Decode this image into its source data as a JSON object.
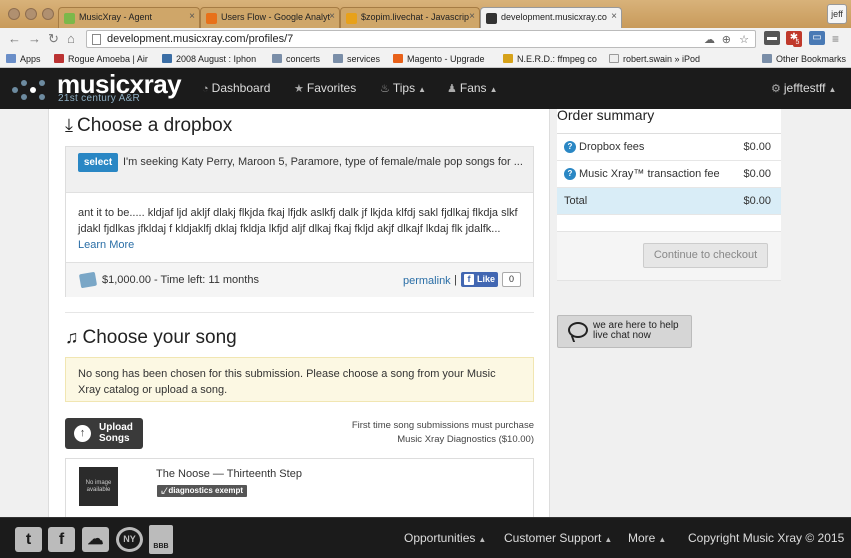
{
  "browser": {
    "tabs": [
      {
        "label": "MusicXray - Agent",
        "fav_color": "#7cb84a"
      },
      {
        "label": "Users Flow - Google Analyt",
        "fav_color": "#e8711a"
      },
      {
        "label": "$zopim.livechat - Javascrip",
        "fav_color": "#e8a11a"
      },
      {
        "label": "development.musicxray.co",
        "fav_color": "#333333"
      }
    ],
    "user_chip": "jeff",
    "url": "development.musicxray.com/profiles/7",
    "ext_badge": "5",
    "bookmarks": [
      {
        "label": "Apps"
      },
      {
        "label": "Rogue Amoeba | Air"
      },
      {
        "label": "2008 August : Iphon"
      },
      {
        "label": "concerts"
      },
      {
        "label": "services"
      },
      {
        "label": "Magento - Upgrade"
      },
      {
        "label": "N.E.R.D.: ffmpeg co"
      },
      {
        "label": "robert.swain » iPod"
      }
    ],
    "other_bookmarks": "Other Bookmarks"
  },
  "site_nav": {
    "logo": "musicxray",
    "tagline": "21st century A&R",
    "dashboard": "Dashboard",
    "favorites": "Favorites",
    "tips": "Tips",
    "fans": "Fans",
    "user": "jefftestff"
  },
  "dropbox_section": {
    "title": "Choose a dropbox",
    "select_label": "select",
    "dropbox_title": "I'm seeking Katy Perry, Maroon 5, Paramore, type of female/male pop songs for ...",
    "description": "ant it to be..... kldjaf ljd akljf dlakj flkjda fkaj lfjdk aslkfj dalk jf lkjda klfdj sakl fjdlkaj flkdja slkf jdakl fjdlkas jfkldaj f kldjaklfj dklaj fkldja lkfjd aljf dlkaj fkaj fkljd akjf dlkajf lkdaj flk jdalfk...",
    "learn_more": "Learn More",
    "price_time": "$1,000.00 - Time left: 11 months",
    "permalink": "permalink",
    "pipe": "|",
    "like_label": "Like",
    "like_count": "0"
  },
  "song_section": {
    "title": "Choose your song",
    "notice": "No song has been chosen for this submission. Please choose a song from your Music Xray catalog or upload a song.",
    "upload_label_1": "Upload",
    "upload_label_2": "Songs",
    "purchase_note_1": "First time song submissions must purchase",
    "purchase_note_2": "Music Xray Diagnostics ($10.00)",
    "songs": [
      {
        "title": "The Noose — Thirteenth Step",
        "image_text": "No image available",
        "badge": "diagnostics exempt"
      }
    ]
  },
  "order_summary": {
    "title": "Order summary",
    "rows": [
      {
        "label": "Dropbox fees",
        "amount": "$0.00"
      },
      {
        "label": "Music Xray™ transaction fee",
        "amount": "$0.00"
      }
    ],
    "total_label": "Total",
    "total_amount": "$0.00",
    "checkout_label": "Continue to checkout"
  },
  "livechat": {
    "line1": "we are here to help",
    "line2": "live chat now"
  },
  "footer": {
    "opportunities": "Opportunities",
    "customer_support": "Customer Support",
    "more": "More",
    "copyright": "Copyright Music Xray © 2015",
    "social": [
      {
        "name": "twitter",
        "glyph": "t"
      },
      {
        "name": "facebook",
        "glyph": "f"
      },
      {
        "name": "soundcloud",
        "glyph": "☁"
      },
      {
        "name": "ny",
        "glyph": "NY"
      },
      {
        "name": "bbb",
        "glyph": "BBB"
      }
    ]
  },
  "colors": {
    "accent_blue": "#2a87c4",
    "nav_bg": "#1b1b1b",
    "notice_bg": "#fcf8e3",
    "total_bg": "#d9edf7"
  }
}
